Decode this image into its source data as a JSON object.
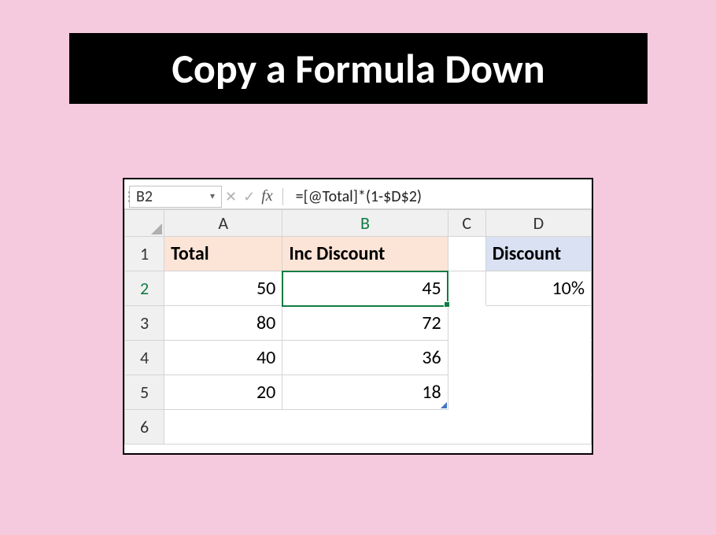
{
  "title": "Copy a Formula Down",
  "formula_bar": {
    "name_box": "B2",
    "cancel_icon": "✕",
    "enter_icon": "✓",
    "fx_label": "fx",
    "formula": "=[@Total]*(1-$D$2)"
  },
  "columns": [
    "A",
    "B",
    "C",
    "D"
  ],
  "row_numbers": [
    "1",
    "2",
    "3",
    "4",
    "5",
    "6"
  ],
  "headers": {
    "a": "Total",
    "b": "Inc Discount",
    "d": "Discount"
  },
  "data": {
    "a": [
      "50",
      "80",
      "40",
      "20"
    ],
    "b": [
      "45",
      "72",
      "36",
      "18"
    ],
    "d2": "10%"
  },
  "active_cell": "B2",
  "chart_data": {
    "type": "table",
    "title": "Copy a Formula Down",
    "columns": [
      "Total",
      "Inc Discount"
    ],
    "rows": [
      {
        "Total": 50,
        "Inc Discount": 45
      },
      {
        "Total": 80,
        "Inc Discount": 72
      },
      {
        "Total": 40,
        "Inc Discount": 36
      },
      {
        "Total": 20,
        "Inc Discount": 18
      }
    ],
    "side_table": {
      "Discount": "10%"
    },
    "formula": "=[@Total]*(1-$D$2)"
  }
}
